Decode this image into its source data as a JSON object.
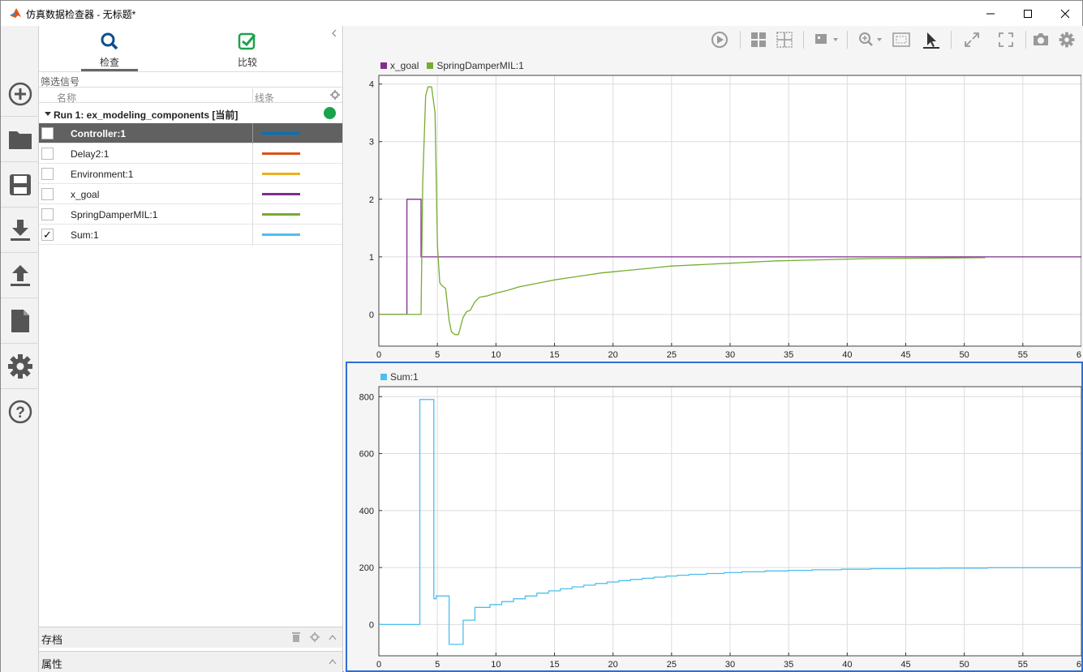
{
  "window": {
    "title": "仿真数据检查器 - 无标题*",
    "controls": [
      "minimize-icon",
      "maximize-icon",
      "close-icon"
    ]
  },
  "left_rail": {
    "buttons": [
      {
        "name": "new-icon"
      },
      {
        "name": "open-folder-icon"
      },
      {
        "name": "save-icon"
      },
      {
        "name": "import-icon"
      },
      {
        "name": "export-icon"
      },
      {
        "name": "report-icon"
      },
      {
        "name": "settings-icon"
      },
      {
        "name": "help-icon"
      }
    ]
  },
  "browser": {
    "tabs": [
      {
        "label": "检查",
        "icon": "search-icon",
        "active": true
      },
      {
        "label": "比较",
        "icon": "compare-check-icon",
        "active": false
      }
    ],
    "filter_placeholder": "筛选信号",
    "columns": {
      "name": "名称",
      "line": "线条"
    },
    "run": {
      "label": "Run 1: ex_modeling_components [当前]",
      "status_color": "#1aa34a"
    },
    "signals": [
      {
        "name": "Controller:1",
        "color": "#0072bd",
        "checked": false,
        "selected": true
      },
      {
        "name": "Delay2:1",
        "color": "#d95319",
        "checked": false,
        "selected": false
      },
      {
        "name": "Environment:1",
        "color": "#edb120",
        "checked": false,
        "selected": false
      },
      {
        "name": "x_goal",
        "color": "#7e2f8e",
        "checked": false,
        "selected": false
      },
      {
        "name": "SpringDamperMIL:1",
        "color": "#77ac30",
        "checked": false,
        "selected": false
      },
      {
        "name": "Sum:1",
        "color": "#4dbeee",
        "checked": true,
        "checkmark": "✓",
        "selected": false
      }
    ],
    "sections": {
      "archive": "存档",
      "properties": "属性"
    }
  },
  "chart_data": [
    {
      "type": "line",
      "title": "",
      "xlabel": "",
      "ylabel": "",
      "xlim": [
        0,
        60
      ],
      "ylim": [
        -0.55,
        4.15
      ],
      "xticks": [
        0,
        5,
        10,
        15,
        20,
        25,
        30,
        35,
        40,
        45,
        50,
        55,
        60
      ],
      "yticks": [
        0,
        1,
        2,
        3,
        4
      ],
      "grid": true,
      "legend_position": "top-left",
      "series": [
        {
          "name": "x_goal",
          "color": "#7e2f8e",
          "x": [
            0,
            2.4,
            2.4,
            3.6,
            3.6,
            60
          ],
          "y": [
            0,
            0,
            2,
            2,
            1,
            1
          ]
        },
        {
          "name": "SpringDamperMIL:1",
          "color": "#77ac30",
          "x": [
            0,
            3.6,
            3.75,
            4.0,
            4.2,
            4.5,
            4.8,
            5.0,
            5.2,
            5.4,
            5.7,
            6.0,
            6.2,
            6.5,
            6.8,
            7.2,
            7.5,
            7.8,
            8.2,
            8.6,
            9.2,
            10,
            11,
            12,
            13,
            14,
            15,
            16,
            17,
            18,
            19,
            20,
            21,
            22,
            23,
            24,
            25,
            26,
            27,
            28,
            29,
            30,
            31,
            32,
            33,
            34,
            35,
            36,
            38,
            40,
            42,
            45,
            48,
            51.8
          ],
          "y": [
            0,
            0,
            2.3,
            3.8,
            3.95,
            3.95,
            3.5,
            1.2,
            0.55,
            0.5,
            0.45,
            -0.1,
            -0.3,
            -0.35,
            -0.35,
            -0.05,
            0.05,
            0.07,
            0.22,
            0.3,
            0.32,
            0.37,
            0.42,
            0.48,
            0.52,
            0.56,
            0.6,
            0.63,
            0.66,
            0.69,
            0.72,
            0.74,
            0.76,
            0.78,
            0.8,
            0.82,
            0.84,
            0.85,
            0.86,
            0.87,
            0.88,
            0.89,
            0.9,
            0.91,
            0.92,
            0.93,
            0.935,
            0.94,
            0.95,
            0.96,
            0.97,
            0.975,
            0.98,
            0.985
          ]
        }
      ]
    },
    {
      "type": "line",
      "title": "",
      "xlabel": "",
      "ylabel": "",
      "xlim": [
        0,
        60
      ],
      "ylim": [
        -110,
        835
      ],
      "xticks": [
        0,
        5,
        10,
        15,
        20,
        25,
        30,
        35,
        40,
        45,
        50,
        55,
        60
      ],
      "yticks": [
        0,
        200,
        400,
        600,
        800
      ],
      "grid": true,
      "legend_position": "top-left",
      "series": [
        {
          "name": "Sum:1",
          "color": "#4dbeee",
          "x": [
            0,
            3.5,
            3.5,
            4.7,
            4.7,
            4.9,
            4.9,
            6.0,
            6.0,
            7.2,
            7.2,
            8.2,
            8.2,
            9.5,
            9.5,
            10.5,
            10.5,
            11.5,
            11.5,
            12.5,
            12.5,
            13.5,
            13.5,
            14.5,
            14.5,
            15.5,
            15.5,
            16.5,
            16.5,
            17.5,
            17.5,
            18.5,
            18.5,
            19.5,
            19.5,
            20.5,
            20.5,
            21.5,
            21.5,
            22.5,
            22.5,
            23.5,
            23.5,
            24.5,
            24.5,
            25.5,
            25.5,
            26.5,
            26.5,
            28,
            28,
            29.5,
            29.5,
            31,
            31,
            33,
            33,
            35,
            35,
            37,
            37,
            39.5,
            39.5,
            42,
            42,
            45,
            45,
            48,
            48,
            52,
            52,
            60
          ],
          "y": [
            0,
            0,
            790,
            790,
            90,
            90,
            100,
            100,
            -70,
            -70,
            15,
            15,
            60,
            60,
            70,
            70,
            80,
            80,
            90,
            90,
            100,
            100,
            110,
            110,
            118,
            118,
            125,
            125,
            132,
            132,
            138,
            138,
            144,
            144,
            149,
            149,
            154,
            154,
            158,
            158,
            162,
            162,
            166,
            166,
            170,
            170,
            173,
            173,
            176,
            176,
            179,
            179,
            182,
            182,
            185,
            185,
            188,
            188,
            190,
            190,
            192,
            192,
            194,
            194,
            196,
            196,
            197,
            197,
            198,
            198,
            199,
            199
          ]
        }
      ]
    }
  ]
}
